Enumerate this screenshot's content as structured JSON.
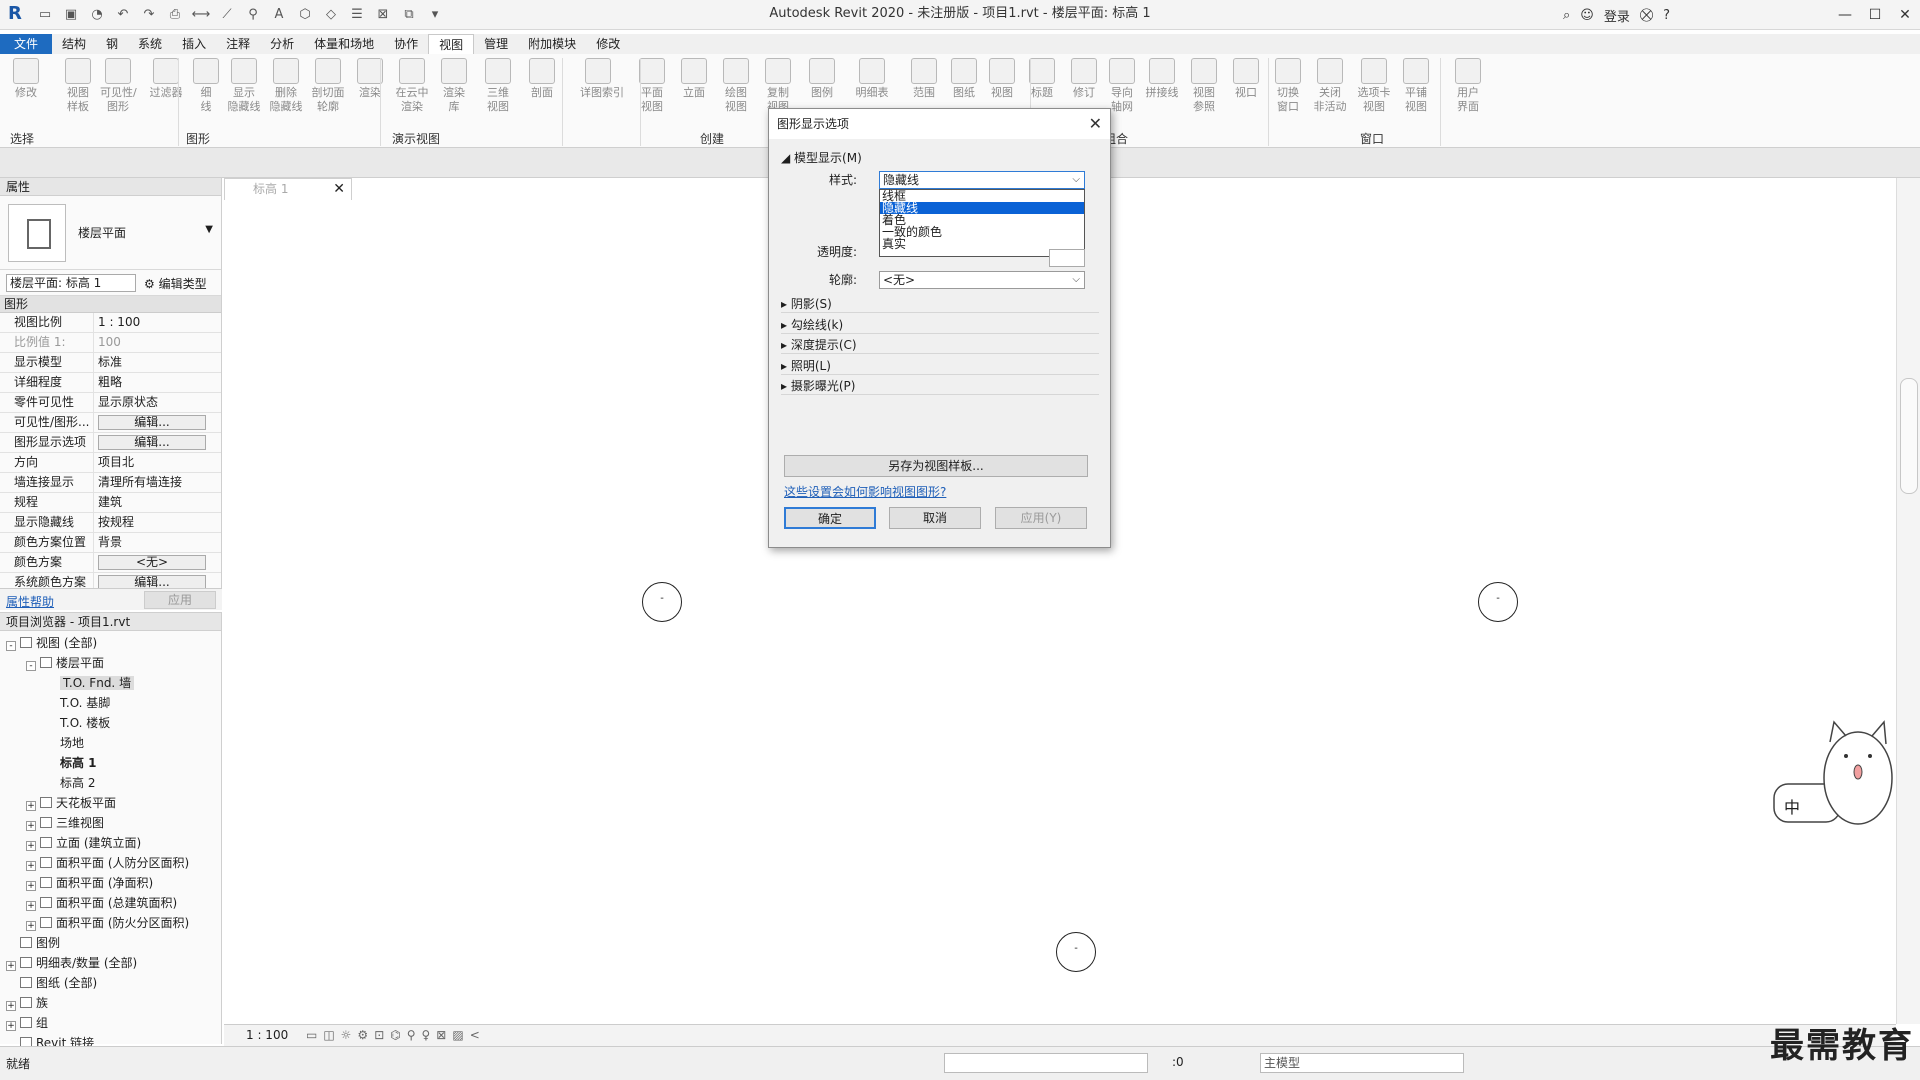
{
  "app": {
    "title": "Autodesk Revit 2020 - 未注册版 - 项目1.rvt - 楼层平面: 标高 1",
    "login": "登录"
  },
  "menu": {
    "tabs": [
      "文件",
      "结构",
      "钢",
      "系统",
      "插入",
      "注释",
      "分析",
      "体量和场地",
      "协作",
      "视图",
      "管理",
      "附加模块",
      "修改"
    ]
  },
  "ribbon": {
    "buttons": [
      {
        "label": "修改"
      },
      {
        "label": "视图\n样板"
      },
      {
        "label": "可见性/\n图形"
      },
      {
        "label": "过滤器"
      },
      {
        "label": "细\n线"
      },
      {
        "label": "显示\n隐藏线"
      },
      {
        "label": "删除\n隐藏线"
      },
      {
        "label": "剖切面\n轮廓"
      },
      {
        "label": "渲染"
      },
      {
        "label": "在云中\n渲染"
      },
      {
        "label": "渲染\n库"
      },
      {
        "label": "三维\n视图"
      },
      {
        "label": "剖面"
      },
      {
        "label": "详图索引"
      },
      {
        "label": "平面\n视图"
      },
      {
        "label": "立面"
      },
      {
        "label": "绘图\n视图"
      },
      {
        "label": "复制\n视图"
      },
      {
        "label": "图例"
      },
      {
        "label": "明细表"
      },
      {
        "label": "范围"
      },
      {
        "label": "图纸"
      },
      {
        "label": "视图"
      },
      {
        "label": "标题"
      },
      {
        "label": "修订"
      },
      {
        "label": "导向\n轴网"
      },
      {
        "label": "拼接线"
      },
      {
        "label": "视图\n参照"
      },
      {
        "label": "视口"
      },
      {
        "label": "切换\n窗口"
      },
      {
        "label": "关闭\n非活动"
      },
      {
        "label": "选项卡\n视图"
      },
      {
        "label": "平铺\n视图"
      },
      {
        "label": "用户\n界面"
      }
    ],
    "groups": {
      "select": "选择",
      "graphics": "图形",
      "presentation": "演示视图",
      "create": "创建",
      "sheet": "图纸组合",
      "window": "窗口"
    }
  },
  "properties": {
    "header": "属性",
    "type_name": "楼层平面",
    "selector": "楼层平面: 标高 1",
    "edit_type": "编辑类型",
    "group": "图形",
    "rows": [
      {
        "k": "视图比例",
        "v": "1 : 100"
      },
      {
        "k": "比例值 1:",
        "v": "100"
      },
      {
        "k": "显示模型",
        "v": "标准"
      },
      {
        "k": "详细程度",
        "v": "粗略"
      },
      {
        "k": "零件可见性",
        "v": "显示原状态"
      },
      {
        "k": "可见性/图形...",
        "v": "编辑..."
      },
      {
        "k": "图形显示选项",
        "v": "编辑..."
      },
      {
        "k": "方向",
        "v": "项目北"
      },
      {
        "k": "墙连接显示",
        "v": "清理所有墙连接"
      },
      {
        "k": "规程",
        "v": "建筑"
      },
      {
        "k": "显示隐藏线",
        "v": "按规程"
      },
      {
        "k": "颜色方案位置",
        "v": "背景"
      },
      {
        "k": "颜色方案",
        "v": "<无>"
      },
      {
        "k": "系统颜色方案",
        "v": "编辑..."
      }
    ],
    "help": "属性帮助",
    "apply": "应用"
  },
  "browser": {
    "header": "项目浏览器 - 项目1.rvt",
    "nodes": [
      {
        "label": "视图 (全部)",
        "level": 0,
        "toggle": "-"
      },
      {
        "label": "楼层平面",
        "level": 1,
        "toggle": "-"
      },
      {
        "label": "T.O. Fnd. 墙",
        "level": 2,
        "toggle": ""
      },
      {
        "label": "T.O. 基脚",
        "level": 2,
        "toggle": ""
      },
      {
        "label": "T.O. 楼板",
        "level": 2,
        "toggle": ""
      },
      {
        "label": "场地",
        "level": 2,
        "toggle": ""
      },
      {
        "label": "标高 1",
        "level": 2,
        "toggle": ""
      },
      {
        "label": "标高 2",
        "level": 2,
        "toggle": ""
      },
      {
        "label": "天花板平面",
        "level": 1,
        "toggle": "+"
      },
      {
        "label": "三维视图",
        "level": 1,
        "toggle": "+"
      },
      {
        "label": "立面 (建筑立面)",
        "level": 1,
        "toggle": "+"
      },
      {
        "label": "面积平面 (人防分区面积)",
        "level": 1,
        "toggle": "+"
      },
      {
        "label": "面积平面 (净面积)",
        "level": 1,
        "toggle": "+"
      },
      {
        "label": "面积平面 (总建筑面积)",
        "level": 1,
        "toggle": "+"
      },
      {
        "label": "面积平面 (防火分区面积)",
        "level": 1,
        "toggle": "+"
      },
      {
        "label": "图例",
        "level": 0,
        "toggle": ""
      },
      {
        "label": "明细表/数量 (全部)",
        "level": 0,
        "toggle": "+"
      },
      {
        "label": "图纸 (全部)",
        "level": 0,
        "toggle": ""
      },
      {
        "label": "族",
        "level": 0,
        "toggle": "+"
      },
      {
        "label": "组",
        "level": 0,
        "toggle": "+"
      },
      {
        "label": "Revit 链接",
        "level": 0,
        "toggle": ""
      }
    ]
  },
  "doc_tab": {
    "label": "标高 1"
  },
  "viewctl": {
    "scale": "1 : 100"
  },
  "status": {
    "ready": "就绪",
    "coord": ":0",
    "model": "主模型"
  },
  "dialog": {
    "title": "图形显示选项",
    "section_model": "模型显示(M)",
    "style_label": "样式:",
    "style_value": "隐藏线",
    "style_options": [
      "线框",
      "隐藏线",
      "着色",
      "一致的颜色",
      "真实"
    ],
    "transparency_label": "透明度:",
    "outline_label": "轮廓:",
    "outline_value": "<无>",
    "sections": [
      "阴影(S)",
      "勾绘线(k)",
      "深度提示(C)",
      "照明(L)",
      "摄影曝光(P)"
    ],
    "save_template": "另存为视图样板...",
    "link": "这些设置会如何影响视图图形?",
    "ok": "确定",
    "cancel": "取消",
    "apply": "应用(Y)"
  },
  "ime": {
    "label": "中"
  },
  "watermark": "最需教育"
}
